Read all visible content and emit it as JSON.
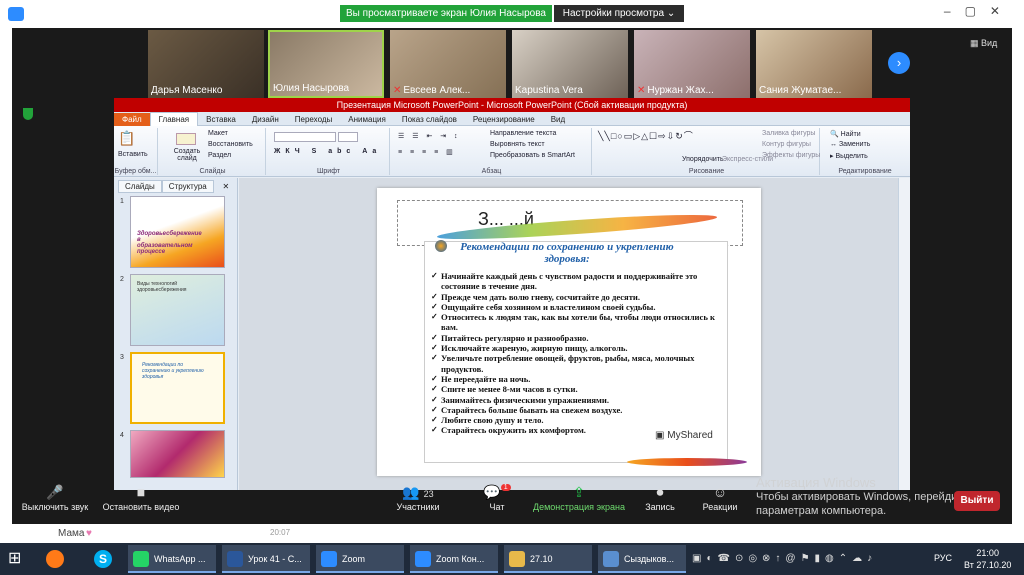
{
  "zoom": {
    "share_banner": "Вы просматриваете экран Юлия Насырова",
    "share_settings": "Настройки просмотра",
    "view_label": "Вид",
    "participants": [
      {
        "name": "Дарья Масенко",
        "muted": false
      },
      {
        "name": "Юлия Насырова",
        "muted": false
      },
      {
        "name": "Евсеев Алек...",
        "muted": true
      },
      {
        "name": "Kapustina Vera",
        "muted": false
      },
      {
        "name": "Нуржан Жах...",
        "muted": true
      },
      {
        "name": "Сания Жуматае...",
        "muted": false
      }
    ],
    "toolbar": {
      "mute": "Выключить звук",
      "video": "Остановить видео",
      "participants": "Участники",
      "participants_count": "23",
      "chat": "Чат",
      "chat_badge": "1",
      "share": "Демонстрация экрана",
      "record": "Запись",
      "reactions": "Реакции",
      "exit": "Выйти"
    },
    "activation": {
      "title": "Активация Windows",
      "line1": "Чтобы активировать Windows, перейдите",
      "line2": "параметрам компьютера."
    },
    "chat_preview": {
      "name": "Мама",
      "time": "20:07"
    }
  },
  "ppt": {
    "title": "Презентация Microsoft PowerPoint - Microsoft PowerPoint (Сбой активации продукта)",
    "tabs": [
      "Файл",
      "Главная",
      "Вставка",
      "Дизайн",
      "Переходы",
      "Анимация",
      "Показ слайдов",
      "Рецензирование",
      "Вид"
    ],
    "ribbon": {
      "paste": "Вставить",
      "new_slide": "Создать слайд",
      "layout": "Макет",
      "reset": "Восстановить",
      "section": "Раздел",
      "text_direction": "Направление текста",
      "align_text": "Выровнять текст",
      "smartart": "Преобразовать в SmartArt",
      "arrange": "Упорядочить",
      "quick_styles": "Экспресс-стили",
      "shape_fill": "Заливка фигуры",
      "shape_outline": "Контур фигуры",
      "shape_effects": "Эффекты фигуры",
      "find": "Найти",
      "replace": "Заменить",
      "select": "Выделить",
      "groups": [
        "Буфер обм...",
        "Слайды",
        "Шрифт",
        "Абзац",
        "Рисование",
        "Редактирование"
      ]
    },
    "panel_tabs": [
      "Слайды",
      "Структура"
    ],
    "thumbnails": [
      {
        "num": "1",
        "text": "Здоровьесбережение в образовательном процессе"
      },
      {
        "num": "2",
        "text": "Виды технологий здоровьесбережения"
      },
      {
        "num": "3",
        "text": "Рекомендации по сохранению и укреплению здоровья"
      },
      {
        "num": "4",
        "text": ""
      }
    ],
    "slide": {
      "title_placeholder": "З...                ...й",
      "heading": "Рекомендации по сохранению и укреплению здоровья:",
      "items": [
        "Начинайте каждый день с чувством радости и поддерживайте это состояние в течение дня.",
        "Прежде чем дать волю гневу, сосчитайте до десяти.",
        "Ощущайте себя хозяином и властелином своей судьбы.",
        "Относитесь к людям так, как вы хотели бы, чтобы люди относились к вам.",
        "Питайтесь регулярно и разнообразно.",
        "Исключайте жареную, жирную пищу, алкоголь.",
        "Увеличьте потребление овощей, фруктов, рыбы, мяса, молочных продуктов.",
        "Не переедайте на ночь.",
        "Спите не менее 8-ми часов в сутки.",
        "Занимайтесь физическими упражнениями.",
        "Старайтесь больше бывать на свежем воздухе.",
        "Любите свою душу и тело.",
        "Старайтесь окружить их комфортом."
      ],
      "watermark": "MyShared"
    }
  },
  "taskbar": {
    "items": [
      {
        "label": "WhatsApp ...",
        "color": "#25D366"
      },
      {
        "label": "Урок 41 - С...",
        "color": "#2B579A"
      },
      {
        "label": "Zoom",
        "color": "#2D8CFF"
      },
      {
        "label": "Zoom Кон...",
        "color": "#2D8CFF"
      },
      {
        "label": "27.10",
        "color": "#E8B94A"
      },
      {
        "label": "Сыздыков...",
        "color": "#5a8fd0"
      }
    ],
    "lang": "РУС",
    "time": "21:00",
    "date": "Вт 27.10.20"
  }
}
